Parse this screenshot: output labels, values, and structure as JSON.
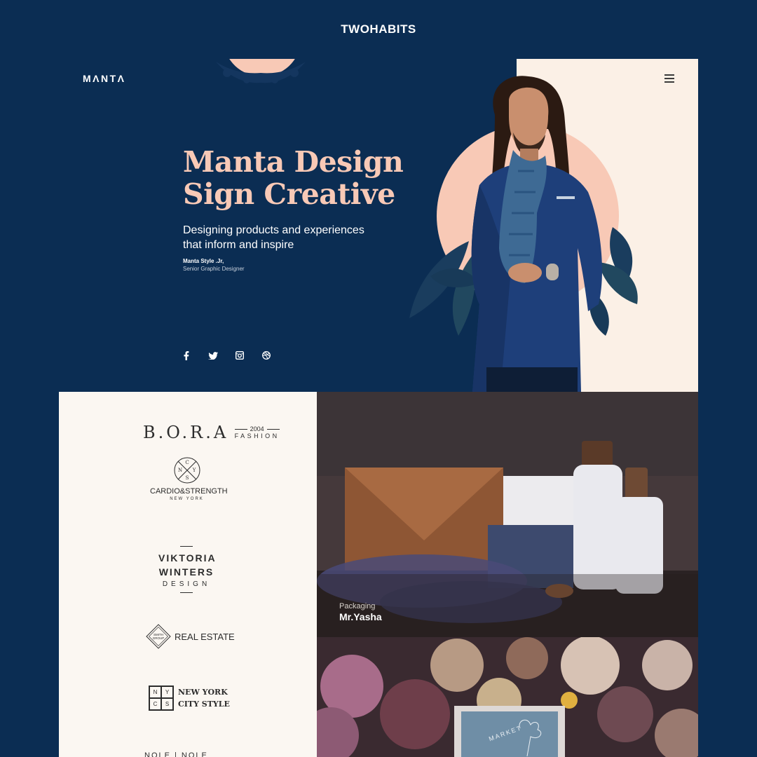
{
  "brand": {
    "name": "TWOHABITS"
  },
  "site": {
    "logo": "MΛNTΛ",
    "hero": {
      "title_line1": "Manta Design",
      "title_line2": "Sign Creative",
      "subtitle_line1": "Designing products and experiences",
      "subtitle_line2": "that inform and inspire",
      "author_name": "Manta Style .Jr,",
      "author_role": "Senior Graphic Designer"
    },
    "socials": [
      "facebook-icon",
      "twitter-icon",
      "instagram-icon",
      "dribbble-icon"
    ]
  },
  "logos": {
    "bora": {
      "main": "B.O.R.A",
      "year": "2004",
      "sub": "FASHION"
    },
    "cardio": {
      "letters": [
        "C",
        "N",
        "Y",
        "S"
      ],
      "title": "CARDIO&STRENGTH",
      "city": "NEW YORK"
    },
    "viktoria": {
      "line1": "VIKTORIA",
      "line2": "WINTERS",
      "line3": "DESIGN"
    },
    "smith": {
      "badge_line1": "SMITH",
      "badge_line2": "GROUP",
      "label": "REAL ESTATE"
    },
    "nyc": {
      "cells": [
        "N",
        "Y",
        "C",
        "S"
      ],
      "line1": "NEW YORK",
      "line2": "CITY STYLE"
    },
    "bottom": "NOLE | NOLE"
  },
  "projects": [
    {
      "category": "Packaging",
      "name": "Mr.Yasha"
    },
    {
      "badge_text": "MARKET"
    }
  ],
  "colors": {
    "navy": "#0b2d53",
    "peach": "#f8c9b6",
    "cream": "#fbf0e6",
    "panel": "#fbf7f2"
  }
}
